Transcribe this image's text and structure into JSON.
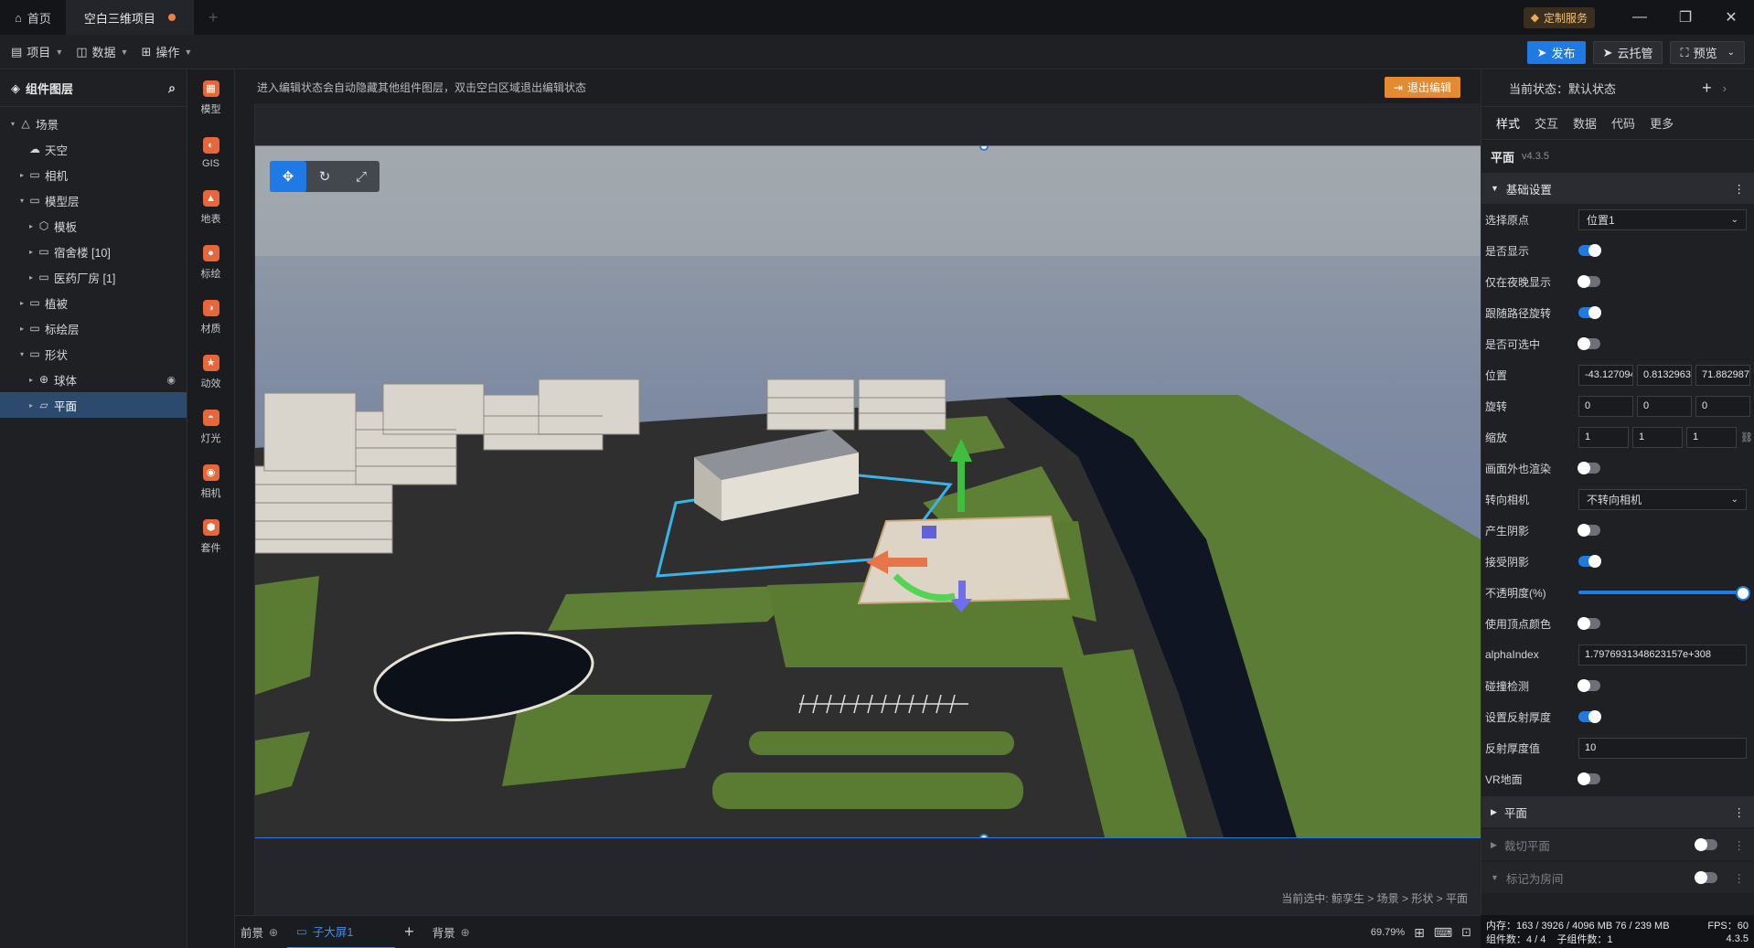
{
  "titlebar": {
    "tabs": [
      {
        "label": "首页",
        "icon": "home-icon"
      },
      {
        "label": "空白三维项目",
        "modified": true
      }
    ],
    "custom_service": "定制服务",
    "window_controls": [
      "—",
      "❐",
      "✕"
    ]
  },
  "menubar": {
    "menus": [
      {
        "label": "项目",
        "icon": "file-icon"
      },
      {
        "label": "数据",
        "icon": "database-icon"
      },
      {
        "label": "操作",
        "icon": "grid-icon"
      }
    ],
    "publish": "发布",
    "cloud": "云托管",
    "preview": "预览"
  },
  "layers": {
    "title": "组件图层",
    "items": [
      {
        "label": "场景",
        "arrow": "▾",
        "icon": "△",
        "indent": 0
      },
      {
        "label": "天空",
        "arrow": "",
        "icon": "☁",
        "indent": 1
      },
      {
        "label": "相机",
        "arrow": "▸",
        "icon": "▭",
        "indent": 1
      },
      {
        "label": "模型层",
        "arrow": "▾",
        "icon": "▭",
        "indent": 1
      },
      {
        "label": "模板",
        "arrow": "▸",
        "icon": "⬡",
        "indent": 2
      },
      {
        "label": "宿舍楼 [10]",
        "arrow": "▸",
        "icon": "▭",
        "indent": 2
      },
      {
        "label": "医药厂房 [1]",
        "arrow": "▸",
        "icon": "▭",
        "indent": 2
      },
      {
        "label": "植被",
        "arrow": "▸",
        "icon": "▭",
        "indent": 1
      },
      {
        "label": "标绘层",
        "arrow": "▸",
        "icon": "▭",
        "indent": 1
      },
      {
        "label": "形状",
        "arrow": "▾",
        "icon": "▭",
        "indent": 1
      },
      {
        "label": "球体",
        "arrow": "▸",
        "icon": "⊕",
        "indent": 2,
        "eye": true
      },
      {
        "label": "平面",
        "arrow": "▸",
        "icon": "▱",
        "indent": 2,
        "selected": true
      }
    ]
  },
  "tools": [
    {
      "label": "模型",
      "glyph": "▦"
    },
    {
      "label": "GIS",
      "glyph": "◐"
    },
    {
      "label": "地表",
      "glyph": "▲"
    },
    {
      "label": "标绘",
      "glyph": "●"
    },
    {
      "label": "材质",
      "glyph": "◑"
    },
    {
      "label": "动效",
      "glyph": "★"
    },
    {
      "label": "灯光",
      "glyph": "◓"
    },
    {
      "label": "相机",
      "glyph": "◉"
    },
    {
      "label": "套件",
      "glyph": "⬢"
    }
  ],
  "canvas": {
    "hint": "进入编辑状态会自动隐藏其他组件图层，双击空白区域退出编辑状态",
    "exit_edit": "退出编辑",
    "breadcrumb": "当前选中: 鲸孪生 > 场景 > 形状 > 平面"
  },
  "bottom": {
    "tabs": [
      "前景",
      "子大屏1",
      "背景"
    ],
    "zoom": "69.79%"
  },
  "props": {
    "state": "当前状态：默认状态",
    "tabs": [
      "样式",
      "交互",
      "数据",
      "代码",
      "更多"
    ],
    "title": "平面",
    "version": "v4.3.5",
    "section_basic": "基础设置",
    "rows": [
      {
        "label": "选择原点",
        "type": "select",
        "value": "位置1"
      },
      {
        "label": "是否显示",
        "type": "switch",
        "on": true
      },
      {
        "label": "仅在夜晚显示",
        "type": "switch",
        "on": false
      },
      {
        "label": "跟随路径旋转",
        "type": "switch",
        "on": true
      },
      {
        "label": "是否可选中",
        "type": "switch",
        "on": false
      },
      {
        "label": "位置",
        "type": "triple",
        "values": [
          "-43.127094",
          "0.8132963",
          "71.882987"
        ]
      },
      {
        "label": "旋转",
        "type": "triple",
        "values": [
          "0",
          "0",
          "0"
        ]
      },
      {
        "label": "缩放",
        "type": "triple",
        "values": [
          "1",
          "1",
          "1"
        ],
        "link": true
      },
      {
        "label": "画面外也渲染",
        "type": "switch",
        "on": false
      },
      {
        "label": "转向相机",
        "type": "select",
        "value": "不转向相机"
      },
      {
        "label": "产生阴影",
        "type": "switch",
        "on": false
      },
      {
        "label": "接受阴影",
        "type": "switch",
        "on": true
      },
      {
        "label": "不透明度(%)",
        "type": "slider",
        "value": 100
      },
      {
        "label": "使用顶点颜色",
        "type": "switch",
        "on": false
      },
      {
        "label": "alphaIndex",
        "type": "text",
        "value": "1.7976931348623157e+308"
      },
      {
        "label": "碰撞检测",
        "type": "switch",
        "on": false
      },
      {
        "label": "设置反射厚度",
        "type": "switch",
        "on": true
      },
      {
        "label": "反射厚度值",
        "type": "text",
        "value": "10"
      },
      {
        "label": "VR地面",
        "type": "switch",
        "on": false
      }
    ],
    "section_plane": "平面",
    "section_clip": "裁切平面",
    "section_room": "标记为房间"
  },
  "status": {
    "memory": "内存：163 / 3926 / 4096 MB  76 / 239 MB",
    "fps": "FPS：60",
    "components": "组件数：4 / 4",
    "children": "子组件数：1",
    "version": "4.3.5"
  }
}
